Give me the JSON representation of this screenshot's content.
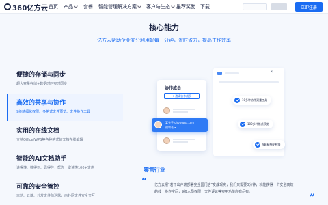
{
  "header": {
    "logo_text": "360亿方云",
    "nav": [
      {
        "label": "首页",
        "has_dropdown": false
      },
      {
        "label": "产品",
        "has_dropdown": true
      },
      {
        "label": "套餐",
        "has_dropdown": false
      },
      {
        "label": "智能管理",
        "has_dropdown": false
      },
      {
        "label": "解决方案",
        "has_dropdown": true
      },
      {
        "label": "客户与生态",
        "has_dropdown": true
      },
      {
        "label": "推荐奖励",
        "has_dropdown": false
      },
      {
        "label": "下载",
        "has_dropdown": false
      }
    ],
    "login_label": "立即注册"
  },
  "section": {
    "title": "核心能力",
    "subtitle": "亿方云帮助企业充分利用好每一分钟，省时省力，提高工作效率"
  },
  "features": [
    {
      "title": "便捷的存储与同步",
      "desc": "超大容量存储+数据时时实时同步",
      "active": false
    },
    {
      "title": "高效的共享与协作",
      "desc": "9级精细化权限、多格式文件预览、文件协作工具",
      "active": true
    },
    {
      "title": "实用的在线文档",
      "desc": "支持Office/WPS等各种格式的文档在线编辑",
      "active": false
    },
    {
      "title": "智能的AI文档助手",
      "desc": "读得懂、搜得到、靠得住，帮你一键读懂100+文件",
      "active": false
    },
    {
      "title": "可靠的安全管控",
      "desc": "本地、云端、外发文件防泄露，内外网文件安全交互",
      "active": false
    }
  ],
  "illustration": {
    "card_title": "协作成员",
    "invite_label": "+ 邀请协作成员",
    "highlight_name": "某头手 chow@xx.com",
    "highlight_role": "编辑者 ▾",
    "pills": [
      "10多种协作双重工具",
      "100多种格式预览",
      "9级精细化权限"
    ],
    "colors": {
      "accent": "#1a6cf2",
      "highlight": "#2f7bf5"
    }
  },
  "industry": {
    "title": "零售行业",
    "quote_open": "“",
    "quote_close": "”",
    "text": "亿方云把“若干出户端部署完全国门店”变成现实，我们只需要3分钟，就能获得一个安全高效的线上协作空间，9级人员权限，文件评论等实用功能应有尽有。"
  }
}
